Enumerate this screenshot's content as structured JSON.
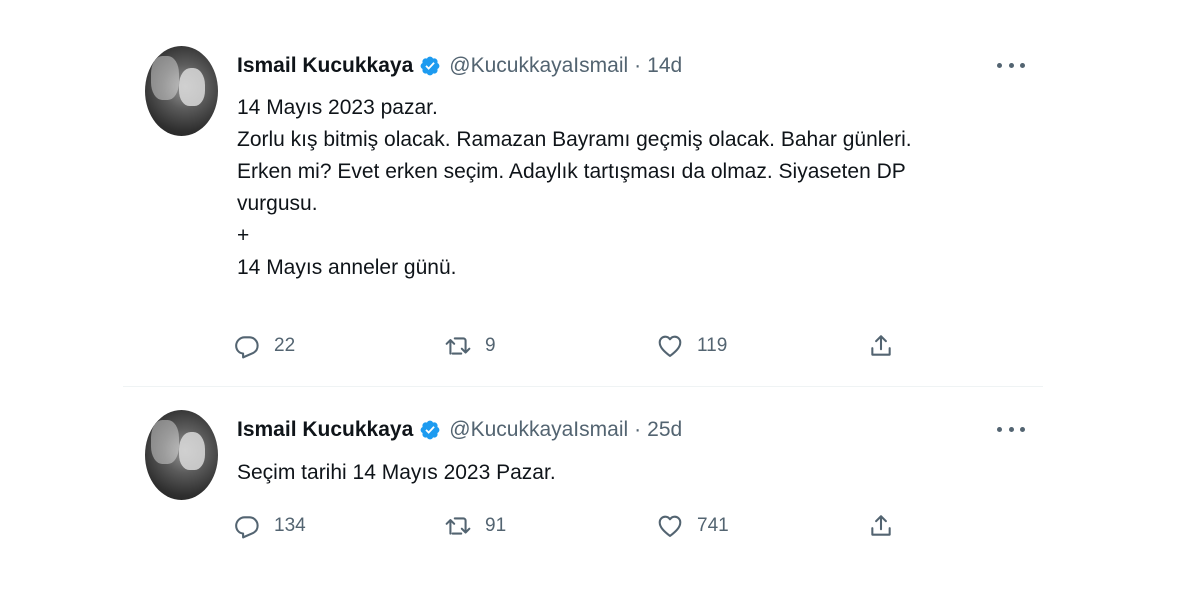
{
  "tweets": [
    {
      "author_name": "Ismail Kucukkaya",
      "handle": "@KucukkayaIsmail",
      "separator": "·",
      "time": "14d",
      "lines": [
        "14 Mayıs 2023 pazar.",
        "Zorlu kış bitmiş olacak. Ramazan Bayramı geçmiş olacak.  Bahar günleri.",
        "Erken mi? Evet erken seçim. Adaylık tartışması da olmaz. Siyaseten DP",
        "vurgusu.",
        "+",
        "14 Mayıs anneler günü."
      ],
      "replies": "22",
      "retweets": "9",
      "likes": "119"
    },
    {
      "author_name": "Ismail Kucukkaya",
      "handle": "@KucukkayaIsmail",
      "separator": "·",
      "time": "25d",
      "lines": [
        "Seçim tarihi 14 Mayıs 2023 Pazar."
      ],
      "replies": "134",
      "retweets": "91",
      "likes": "741"
    }
  ],
  "icons": {
    "verified": "verified-badge-icon",
    "more": "more-horizontal-icon",
    "reply": "reply-icon",
    "retweet": "retweet-icon",
    "like": "heart-icon",
    "share": "share-icon"
  },
  "colors": {
    "verified_blue": "#1d9bf0",
    "muted_text": "#536471",
    "primary_text": "#0f1419"
  }
}
